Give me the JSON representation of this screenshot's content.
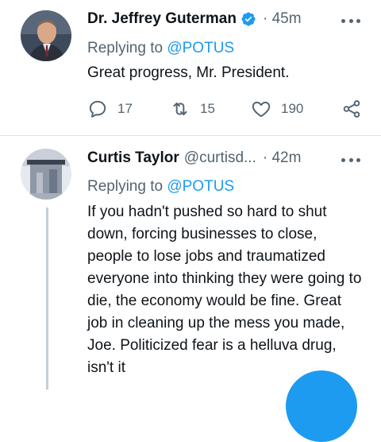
{
  "tweets": [
    {
      "author_name": "Dr. Jeffrey Guterman",
      "verified": true,
      "handle": "",
      "time": "· 45m",
      "replying_label": "Replying to ",
      "replying_handle": "@POTUS",
      "text": "Great progress, Mr. President.",
      "reply_count": "17",
      "retweet_count": "15",
      "like_count": "190"
    },
    {
      "author_name": "Curtis Taylor",
      "verified": false,
      "handle": "@curtisd...",
      "time": "· 42m",
      "replying_label": "Replying to ",
      "replying_handle": "@POTUS",
      "text": "If you hadn't pushed so hard to shut down, forcing businesses to close, people to lose jobs and traumatized everyone into thinking they were going to die, the economy would be fine. Great job in cleaning up the mess you made, Joe. Politicized fear is a helluva drug, isn't it"
    }
  ],
  "colors": {
    "accent": "#1d9bf0",
    "secondary_text": "#536471",
    "primary_text": "#0f1419",
    "divider": "#dfe4e8"
  },
  "icons": {
    "reply": "reply-icon",
    "retweet": "retweet-icon",
    "like": "heart-icon",
    "share": "share-icon",
    "more": "more-icon",
    "verified": "verified-badge-icon"
  }
}
